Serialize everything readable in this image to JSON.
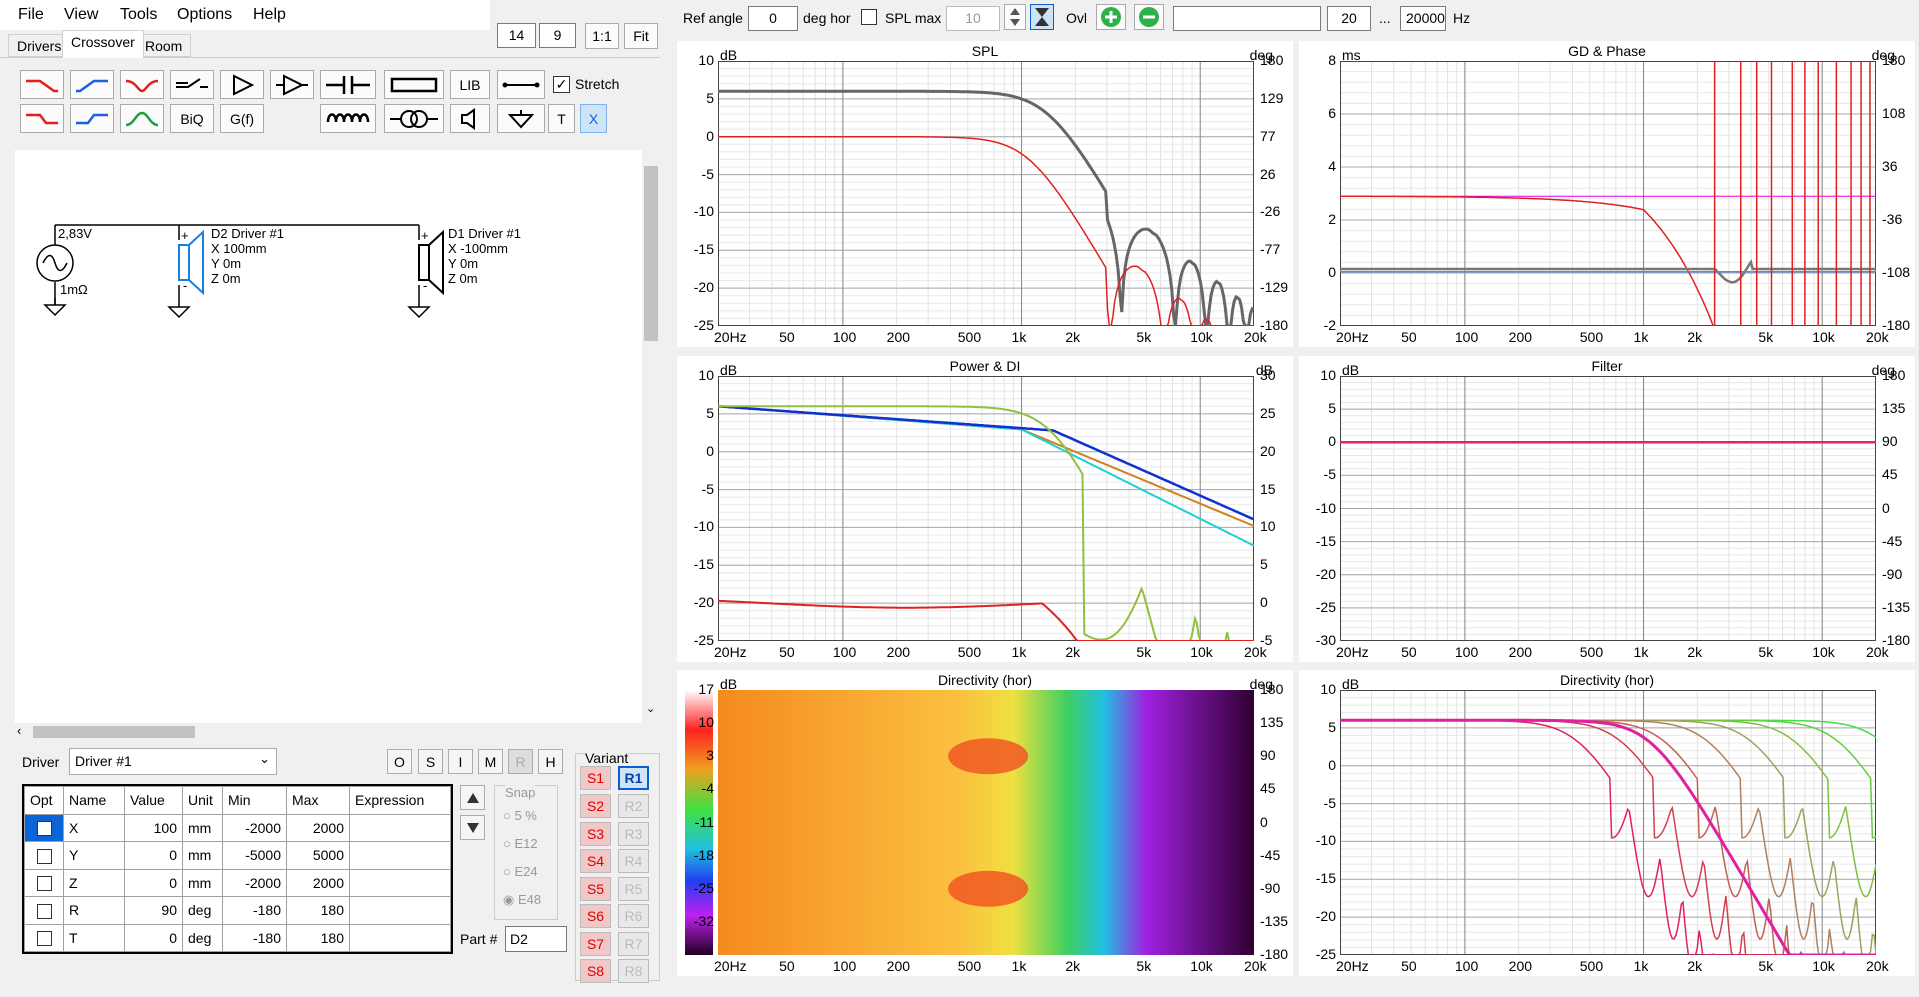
{
  "menu": {
    "file": "File",
    "view": "View",
    "tools": "Tools",
    "options": "Options",
    "help": "Help"
  },
  "tabs": {
    "drivers": "Drivers",
    "crossover": "Crossover",
    "room": "Room"
  },
  "topfields": {
    "a": "14",
    "b": "9",
    "ratio": "1:1",
    "fit": "Fit"
  },
  "toolbar": {
    "lib": "LIB",
    "stretch": "Stretch",
    "biq": "BiQ",
    "gf": "G(f)",
    "t": "T",
    "x": "X"
  },
  "top": {
    "ref_angle_label": "Ref angle",
    "ref_angle": "0",
    "deg_hor": "deg hor",
    "spl_max": "SPL max",
    "spl_max_val": "10",
    "ovl": "Ovl",
    "freq_from": "20",
    "ellipsis": "...",
    "freq_to": "20000",
    "hz": "Hz"
  },
  "schematic": {
    "source_v": "2,83V",
    "source_r": "1mΩ",
    "d2": {
      "name": "D2 Driver #1",
      "x": "X 100mm",
      "y": "Y 0m",
      "z": "Z 0m"
    },
    "d1": {
      "name": "D1 Driver #1",
      "x": "X -100mm",
      "y": "Y 0m",
      "z": "Z 0m"
    },
    "plus": "+",
    "minus": "-"
  },
  "driverpanel": {
    "driver_label": "Driver",
    "driver_value": "Driver #1",
    "btns": [
      "O",
      "S",
      "I",
      "M",
      "R",
      "H"
    ],
    "headers": [
      "Opt",
      "Name",
      "Value",
      "Unit",
      "Min",
      "Max",
      "Expression"
    ],
    "rows": [
      {
        "name": "X",
        "value": "100",
        "unit": "mm",
        "min": "-2000",
        "max": "2000"
      },
      {
        "name": "Y",
        "value": "0",
        "unit": "mm",
        "min": "-5000",
        "max": "5000"
      },
      {
        "name": "Z",
        "value": "0",
        "unit": "mm",
        "min": "-2000",
        "max": "2000"
      },
      {
        "name": "R",
        "value": "90",
        "unit": "deg",
        "min": "-180",
        "max": "180"
      },
      {
        "name": "T",
        "value": "0",
        "unit": "deg",
        "min": "-180",
        "max": "180"
      }
    ],
    "snap": "Snap",
    "snap_opts": [
      "5 %",
      "E12",
      "E24",
      "E48"
    ],
    "part_label": "Part #",
    "part_value": "D2",
    "variant": "Variant",
    "s": [
      "S1",
      "S2",
      "S3",
      "S4",
      "S5",
      "S6",
      "S7",
      "S8"
    ],
    "r": [
      "R1",
      "R2",
      "R3",
      "R4",
      "R5",
      "R6",
      "R7",
      "R8"
    ]
  },
  "xticks": [
    "20Hz",
    "50",
    "100",
    "200",
    "500",
    "1k",
    "2k",
    "5k",
    "10k",
    "20k"
  ],
  "charts": {
    "spl": {
      "title": "SPL",
      "unitL": "dB",
      "unitR": "deg",
      "yL": [
        "10",
        "5",
        "0",
        "-5",
        "-10",
        "-15",
        "-20",
        "-25"
      ],
      "yR": [
        "180",
        "129",
        "77",
        "26",
        "-26",
        "-77",
        "-129",
        "-180"
      ]
    },
    "gd": {
      "title": "GD & Phase",
      "unitL": "ms",
      "unitR": "deg",
      "yL": [
        "8",
        "6",
        "4",
        "2",
        "0",
        "-2"
      ],
      "yR": [
        "180",
        "108",
        "36",
        "-36",
        "-108",
        "-180"
      ]
    },
    "power": {
      "title": "Power & DI",
      "unitL": "dB",
      "unitR": "dB",
      "yL": [
        "10",
        "5",
        "0",
        "-5",
        "-10",
        "-15",
        "-20",
        "-25"
      ],
      "yR": [
        "30",
        "25",
        "20",
        "15",
        "10",
        "5",
        "0",
        "-5"
      ]
    },
    "filter": {
      "title": "Filter",
      "unitL": "dB",
      "unitR": "deg",
      "yL": [
        "10",
        "5",
        "0",
        "-5",
        "-10",
        "-15",
        "-20",
        "-25",
        "-30"
      ],
      "yR": [
        "180",
        "135",
        "90",
        "45",
        "0",
        "-45",
        "-90",
        "-135",
        "-180"
      ]
    },
    "dirmap": {
      "title": "Directivity (hor)",
      "unitL": "dB",
      "unitR": "deg",
      "yL": [
        "17",
        "10",
        "3",
        "-4",
        "-11",
        "-18",
        "-25",
        "-32"
      ],
      "yR": [
        "180",
        "135",
        "90",
        "45",
        "0",
        "-45",
        "-90",
        "-135",
        "-180"
      ]
    },
    "dirlines": {
      "title": "Directivity (hor)",
      "unitL": "dB",
      "yL": [
        "10",
        "5",
        "0",
        "-5",
        "-10",
        "-15",
        "-20",
        "-25"
      ]
    }
  }
}
